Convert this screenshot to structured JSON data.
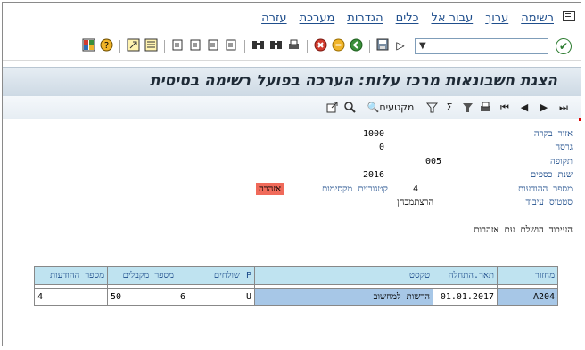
{
  "menu": {
    "items": [
      "רשימה",
      "ערוך",
      "עבור אל",
      "כלים",
      "הגדרות",
      "מערכת",
      "עזרה"
    ]
  },
  "toolbar": {
    "command_value": "",
    "icons": [
      "check-icon",
      "save-icon",
      "back-icon",
      "exit-icon",
      "cancel-icon",
      "print-icon",
      "find-icon",
      "find-next-icon",
      "first-page-icon",
      "prev-page-icon",
      "next-page-icon",
      "last-page-icon",
      "create-session-icon",
      "shortcut-icon",
      "help-icon",
      "layout-icon"
    ]
  },
  "title": "הצגת חשבונאות מרכז עלות: הערכה בפועל רשימה בסיסית",
  "app_toolbar": {
    "segments_label": "מקטעים"
  },
  "header_fields": [
    {
      "label": "אזור בקרה",
      "value": "1000"
    },
    {
      "label": "גרסה",
      "value": "0"
    },
    {
      "label": "תקופה",
      "value": "005"
    },
    {
      "label": "שנת כספים",
      "value": "2016"
    },
    {
      "label": "מספר ההודעות",
      "value": "4"
    },
    {
      "label": "סטטוס עיבוד",
      "value": "הרצתמבחן"
    }
  ],
  "max_category_label": "קטגוריית מקסימום",
  "warning_badge": "אזהרה",
  "status_message": "העיבוד הושלם עם אזהרות",
  "table": {
    "headers": [
      "מחזור",
      "תאר.התחלה",
      "טקסט",
      "P",
      "שולחים",
      "מספר מקבלים",
      "מספר ההודעות"
    ],
    "rows": [
      [
        "A204",
        "01.01.2017",
        "הרשות למחשוב",
        "U",
        "6",
        "50",
        "4"
      ]
    ]
  },
  "colors": {
    "warning": "#f06a5a",
    "header_cell": "#bfe3f0",
    "key_cell": "#a7c7e7",
    "label_blue": "#1f4e8c"
  }
}
